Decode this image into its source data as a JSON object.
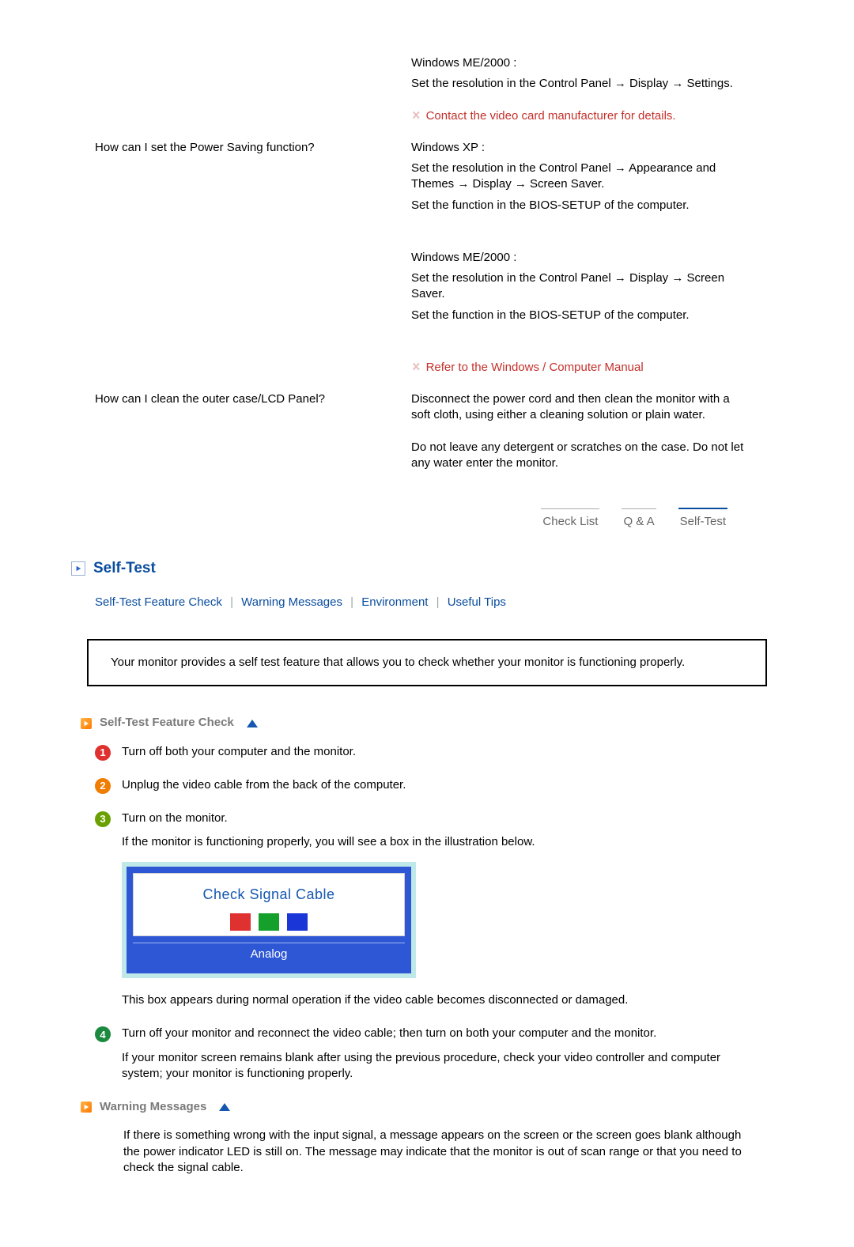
{
  "qa": {
    "prev_answer_me2000": {
      "line1": "Windows ME/2000 :",
      "line2": "Set the resolution in the Control Panel → Display → Settings."
    },
    "note_videocard": "Contact the video card manufacturer for details.",
    "rows": [
      {
        "q": "How can I set the Power Saving function?",
        "a_xp": {
          "line1": "Windows XP :",
          "line2": "Set the resolution in the Control Panel → Appearance and Themes → Display → Screen Saver.",
          "line3": "Set the function in the BIOS-SETUP of the computer."
        },
        "a_me": {
          "line1": "Windows ME/2000 :",
          "line2": "Set the resolution in the Control Panel → Display → Screen Saver.",
          "line3": "Set the function in the BIOS-SETUP of the computer."
        },
        "note": "Refer to the Windows / Computer Manual"
      },
      {
        "q": "How can I clean the outer case/LCD Panel?",
        "a1": "Disconnect the power cord and then clean the monitor with a soft cloth, using either a cleaning solution or plain water.",
        "a2": "Do not leave any detergent or scratches on the case. Do not let any water enter the monitor."
      }
    ]
  },
  "tabs": {
    "check_list": "Check List",
    "qa": "Q & A",
    "self_test": "Self-Test"
  },
  "section": {
    "title": "Self-Test",
    "anchors": {
      "self_test_feature": "Self-Test Feature Check",
      "warning_messages": "Warning Messages",
      "environment": "Environment",
      "useful_tips": "Useful Tips"
    },
    "notebox": "Your monitor provides a self test feature that allows you to check whether your monitor is functioning properly."
  },
  "stfc": {
    "heading": "Self-Test Feature Check",
    "step1": "Turn off both your computer and the monitor.",
    "step2": "Unplug the video cable from the back of the computer.",
    "step3": "Turn on the monitor.",
    "step3_followup": "If the monitor is functioning properly, you will see a box in the illustration below.",
    "signal_title": "Check Signal Cable",
    "signal_footer": "Analog",
    "after_box": "This box appears during normal operation if the video cable becomes disconnected or damaged.",
    "step4a": "Turn off your monitor and reconnect the video cable; then turn on both your computer and the monitor.",
    "step4b": "If your monitor screen remains blank after using the previous procedure, check your video controller and computer system; your monitor is functioning properly."
  },
  "warn": {
    "heading": "Warning Messages",
    "text": "If there is something wrong with the input signal, a message appears on the screen or the screen goes blank although the power indicator LED is still on. The message may indicate that the monitor is out of scan range or that you need to check the signal cable."
  }
}
